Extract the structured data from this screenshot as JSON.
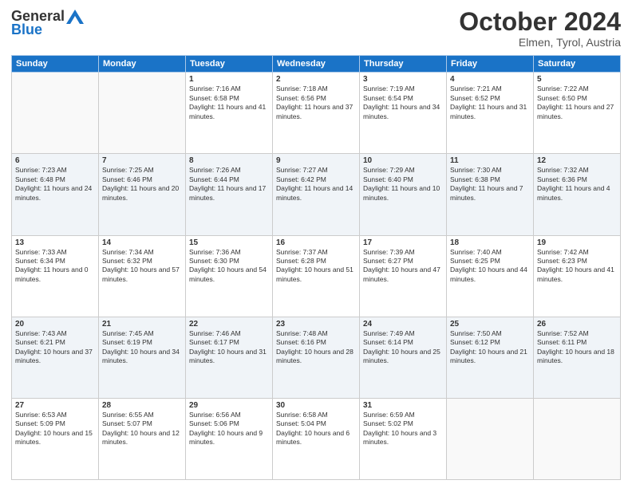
{
  "header": {
    "logo_general": "General",
    "logo_blue": "Blue",
    "month_title": "October 2024",
    "location": "Elmen, Tyrol, Austria"
  },
  "days_of_week": [
    "Sunday",
    "Monday",
    "Tuesday",
    "Wednesday",
    "Thursday",
    "Friday",
    "Saturday"
  ],
  "weeks": [
    [
      {
        "day": "",
        "info": ""
      },
      {
        "day": "",
        "info": ""
      },
      {
        "day": "1",
        "info": "Sunrise: 7:16 AM\nSunset: 6:58 PM\nDaylight: 11 hours and 41 minutes."
      },
      {
        "day": "2",
        "info": "Sunrise: 7:18 AM\nSunset: 6:56 PM\nDaylight: 11 hours and 37 minutes."
      },
      {
        "day": "3",
        "info": "Sunrise: 7:19 AM\nSunset: 6:54 PM\nDaylight: 11 hours and 34 minutes."
      },
      {
        "day": "4",
        "info": "Sunrise: 7:21 AM\nSunset: 6:52 PM\nDaylight: 11 hours and 31 minutes."
      },
      {
        "day": "5",
        "info": "Sunrise: 7:22 AM\nSunset: 6:50 PM\nDaylight: 11 hours and 27 minutes."
      }
    ],
    [
      {
        "day": "6",
        "info": "Sunrise: 7:23 AM\nSunset: 6:48 PM\nDaylight: 11 hours and 24 minutes."
      },
      {
        "day": "7",
        "info": "Sunrise: 7:25 AM\nSunset: 6:46 PM\nDaylight: 11 hours and 20 minutes."
      },
      {
        "day": "8",
        "info": "Sunrise: 7:26 AM\nSunset: 6:44 PM\nDaylight: 11 hours and 17 minutes."
      },
      {
        "day": "9",
        "info": "Sunrise: 7:27 AM\nSunset: 6:42 PM\nDaylight: 11 hours and 14 minutes."
      },
      {
        "day": "10",
        "info": "Sunrise: 7:29 AM\nSunset: 6:40 PM\nDaylight: 11 hours and 10 minutes."
      },
      {
        "day": "11",
        "info": "Sunrise: 7:30 AM\nSunset: 6:38 PM\nDaylight: 11 hours and 7 minutes."
      },
      {
        "day": "12",
        "info": "Sunrise: 7:32 AM\nSunset: 6:36 PM\nDaylight: 11 hours and 4 minutes."
      }
    ],
    [
      {
        "day": "13",
        "info": "Sunrise: 7:33 AM\nSunset: 6:34 PM\nDaylight: 11 hours and 0 minutes."
      },
      {
        "day": "14",
        "info": "Sunrise: 7:34 AM\nSunset: 6:32 PM\nDaylight: 10 hours and 57 minutes."
      },
      {
        "day": "15",
        "info": "Sunrise: 7:36 AM\nSunset: 6:30 PM\nDaylight: 10 hours and 54 minutes."
      },
      {
        "day": "16",
        "info": "Sunrise: 7:37 AM\nSunset: 6:28 PM\nDaylight: 10 hours and 51 minutes."
      },
      {
        "day": "17",
        "info": "Sunrise: 7:39 AM\nSunset: 6:27 PM\nDaylight: 10 hours and 47 minutes."
      },
      {
        "day": "18",
        "info": "Sunrise: 7:40 AM\nSunset: 6:25 PM\nDaylight: 10 hours and 44 minutes."
      },
      {
        "day": "19",
        "info": "Sunrise: 7:42 AM\nSunset: 6:23 PM\nDaylight: 10 hours and 41 minutes."
      }
    ],
    [
      {
        "day": "20",
        "info": "Sunrise: 7:43 AM\nSunset: 6:21 PM\nDaylight: 10 hours and 37 minutes."
      },
      {
        "day": "21",
        "info": "Sunrise: 7:45 AM\nSunset: 6:19 PM\nDaylight: 10 hours and 34 minutes."
      },
      {
        "day": "22",
        "info": "Sunrise: 7:46 AM\nSunset: 6:17 PM\nDaylight: 10 hours and 31 minutes."
      },
      {
        "day": "23",
        "info": "Sunrise: 7:48 AM\nSunset: 6:16 PM\nDaylight: 10 hours and 28 minutes."
      },
      {
        "day": "24",
        "info": "Sunrise: 7:49 AM\nSunset: 6:14 PM\nDaylight: 10 hours and 25 minutes."
      },
      {
        "day": "25",
        "info": "Sunrise: 7:50 AM\nSunset: 6:12 PM\nDaylight: 10 hours and 21 minutes."
      },
      {
        "day": "26",
        "info": "Sunrise: 7:52 AM\nSunset: 6:11 PM\nDaylight: 10 hours and 18 minutes."
      }
    ],
    [
      {
        "day": "27",
        "info": "Sunrise: 6:53 AM\nSunset: 5:09 PM\nDaylight: 10 hours and 15 minutes."
      },
      {
        "day": "28",
        "info": "Sunrise: 6:55 AM\nSunset: 5:07 PM\nDaylight: 10 hours and 12 minutes."
      },
      {
        "day": "29",
        "info": "Sunrise: 6:56 AM\nSunset: 5:06 PM\nDaylight: 10 hours and 9 minutes."
      },
      {
        "day": "30",
        "info": "Sunrise: 6:58 AM\nSunset: 5:04 PM\nDaylight: 10 hours and 6 minutes."
      },
      {
        "day": "31",
        "info": "Sunrise: 6:59 AM\nSunset: 5:02 PM\nDaylight: 10 hours and 3 minutes."
      },
      {
        "day": "",
        "info": ""
      },
      {
        "day": "",
        "info": ""
      }
    ]
  ]
}
